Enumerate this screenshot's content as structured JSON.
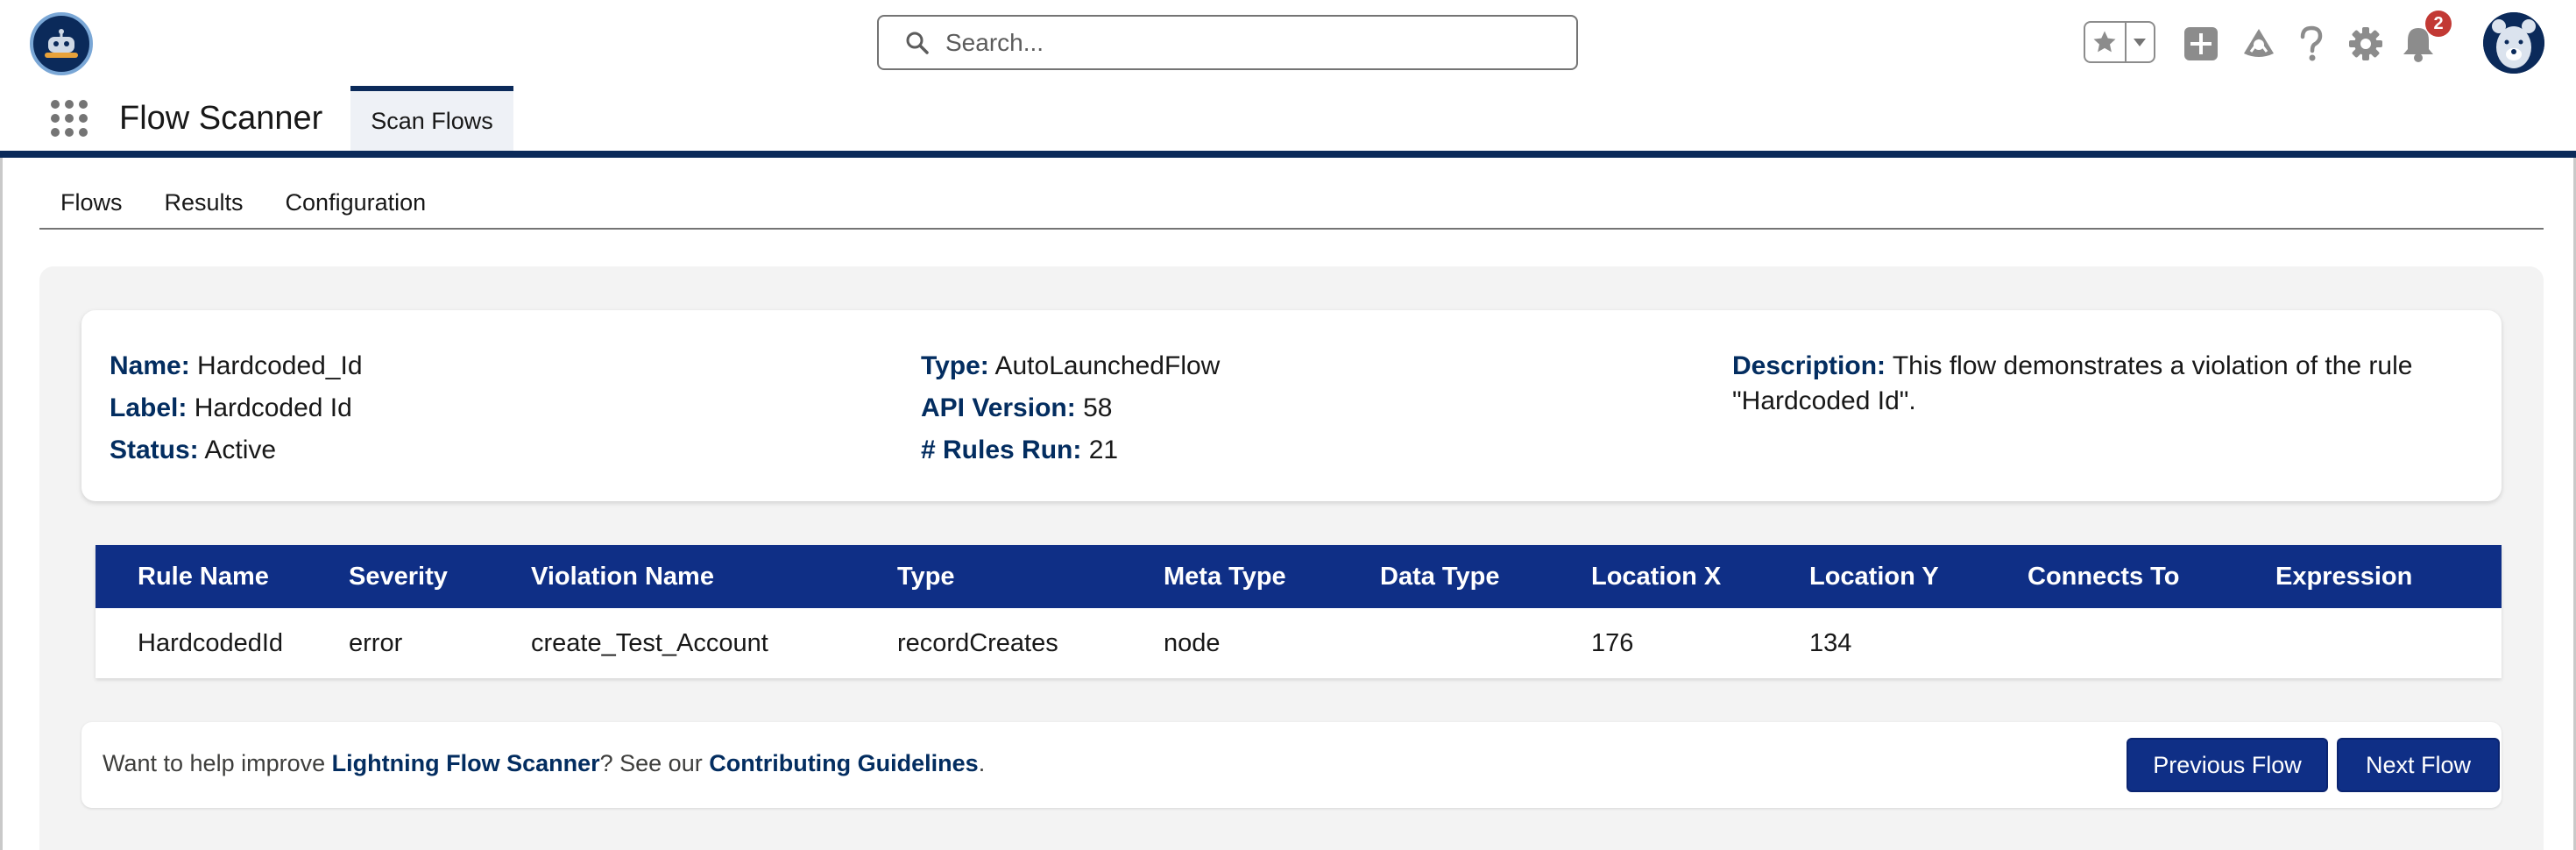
{
  "header": {
    "search_placeholder": "Search...",
    "notification_count": "2",
    "icons": [
      "favorites-star-icon",
      "chevron-down-icon",
      "global-actions-add-icon",
      "trailhead-icon",
      "help-icon",
      "setup-gear-icon",
      "notifications-bell-icon"
    ]
  },
  "app_nav": {
    "app_name": "Flow Scanner",
    "tab": "Scan Flows"
  },
  "page_tabs": [
    "Flows",
    "Results",
    "Configuration"
  ],
  "details": {
    "name_label": "Name:",
    "name_value": "Hardcoded_Id",
    "label_label": "Label:",
    "label_value": "Hardcoded Id",
    "status_label": "Status:",
    "status_value": "Active",
    "type_label": "Type:",
    "type_value": "AutoLaunchedFlow",
    "api_label": "API Version:",
    "api_value": "58",
    "rules_label": "# Rules Run:",
    "rules_value": "21",
    "description_label": "Description:",
    "description_value": "This flow demonstrates a violation of the rule \"Hardcoded Id\"."
  },
  "table": {
    "columns": [
      "Rule Name",
      "Severity",
      "Violation Name",
      "Type",
      "Meta Type",
      "Data Type",
      "Location X",
      "Location Y",
      "Connects To",
      "Expression"
    ],
    "rows": [
      [
        "HardcodedId",
        "error",
        "create_Test_Account",
        "recordCreates",
        "node",
        "",
        "176",
        "134",
        "",
        ""
      ]
    ]
  },
  "footer": {
    "text_before": "Want to help improve ",
    "link1": "Lightning Flow Scanner",
    "text_middle": "? See our ",
    "link2": "Contributing Guidelines",
    "text_after": ".",
    "prev_button": "Previous Flow",
    "next_button": "Next Flow"
  },
  "colors": {
    "brand_navy": "#0b2a5a",
    "table_header": "#0f2f86",
    "label_blue": "#032d60",
    "badge_red": "#c23934"
  }
}
